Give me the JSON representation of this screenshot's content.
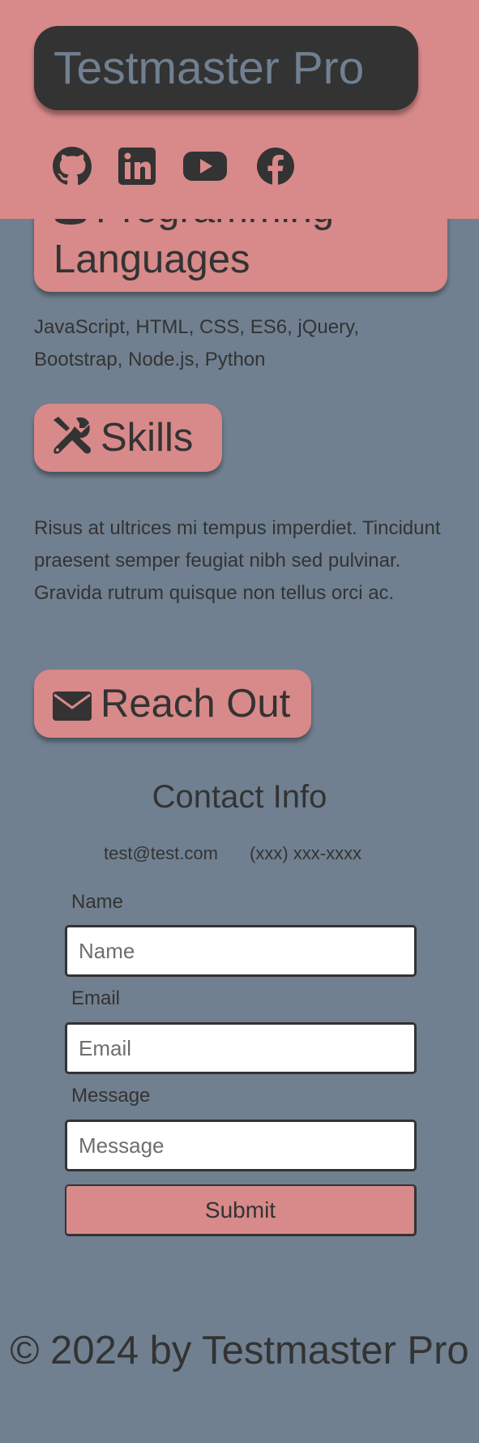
{
  "header": {
    "brand": "Testmaster Pro",
    "social_icons": [
      "github-icon",
      "linkedin-icon",
      "youtube-icon",
      "facebook-icon"
    ]
  },
  "sections": {
    "languages": {
      "heading_line1": "Programming",
      "heading_line2": "Languages",
      "icon": "database-icon",
      "text": "JavaScript, HTML, CSS, ES6, jQuery, Bootstrap, Node.js, Python"
    },
    "skills": {
      "heading": "Skills",
      "icon": "tools-icon",
      "text": "Risus at ultrices mi tempus imperdiet. Tincidunt praesent semper feugiat nibh sed pulvinar. Gravida rutrum quisque non tellus orci ac."
    },
    "contact": {
      "heading": "Reach Out",
      "icon": "envelope-icon",
      "title": "Contact Info",
      "email": "test@test.com",
      "phone": "(xxx) xxx-xxxx",
      "form": {
        "name_label": "Name",
        "name_placeholder": "Name",
        "email_label": "Email",
        "email_placeholder": "Email",
        "message_label": "Message",
        "message_placeholder": "Message",
        "submit_label": "Submit"
      }
    }
  },
  "footer": {
    "copyright": "© 2024 by Testmaster Pro"
  },
  "colors": {
    "page_background": "#708090",
    "accent": "#d88989",
    "dark": "#333333"
  }
}
